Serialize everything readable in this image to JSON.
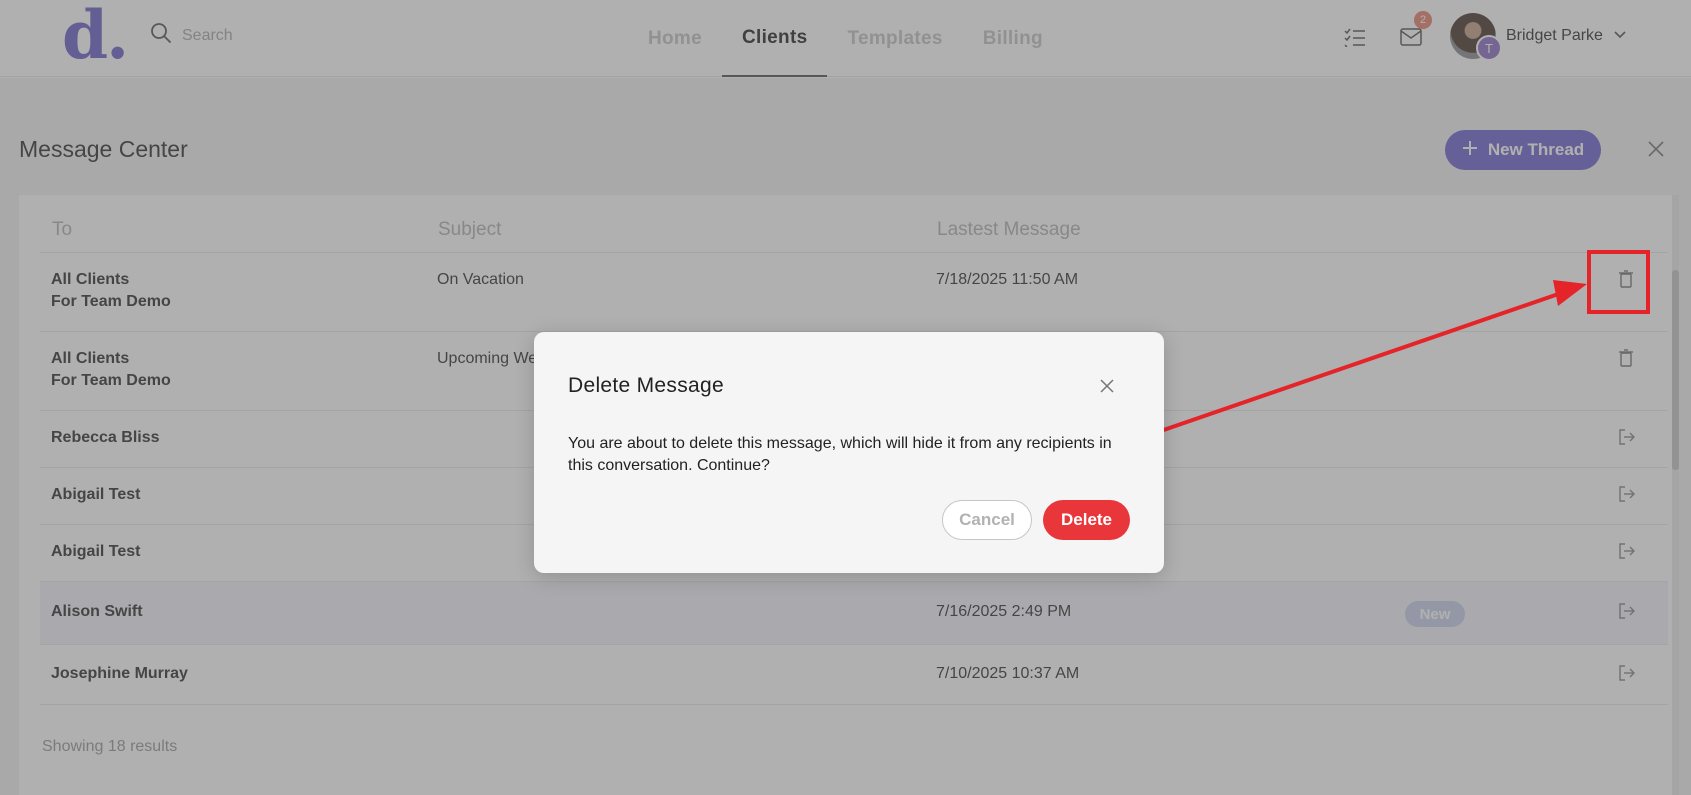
{
  "header": {
    "logo": "d.",
    "search_placeholder": "Search",
    "nav": [
      {
        "label": "Home"
      },
      {
        "label": "Clients"
      },
      {
        "label": "Templates"
      },
      {
        "label": "Billing"
      }
    ],
    "active_nav": "Clients",
    "messages_badge": "2",
    "user": {
      "name": "Bridget Parke",
      "avatar_initial": "T"
    }
  },
  "page": {
    "title": "Message Center",
    "new_thread_label": "New Thread",
    "columns": {
      "to": "To",
      "subject": "Subject",
      "latest": "Lastest Message"
    },
    "rows": [
      {
        "to_line1": "All Clients",
        "to_line2": "For Team Demo",
        "subject": "On Vacation",
        "latest": "7/18/2025 11:50 AM",
        "new": "",
        "action": "trash-icon"
      },
      {
        "to_line1": "All Clients",
        "to_line2": "For Team Demo",
        "subject": "Upcoming We",
        "latest": "",
        "new": "",
        "action": "trash-icon"
      },
      {
        "to_line1": "Rebecca Bliss",
        "to_line2": "",
        "subject": "",
        "latest": "",
        "new": "",
        "action": "open-thread-icon"
      },
      {
        "to_line1": "Abigail Test",
        "to_line2": "",
        "subject": "",
        "latest": "",
        "new": "",
        "action": "open-thread-icon"
      },
      {
        "to_line1": "Abigail Test",
        "to_line2": "",
        "subject": "",
        "latest": "",
        "new": "",
        "action": "open-thread-icon"
      },
      {
        "to_line1": "Alison Swift",
        "to_line2": "",
        "subject": "",
        "latest": "7/16/2025 2:49 PM",
        "new": "New",
        "action": "open-thread-icon"
      },
      {
        "to_line1": "Josephine Murray",
        "to_line2": "",
        "subject": "",
        "latest": "7/10/2025 10:37 AM",
        "new": "",
        "action": "open-thread-icon"
      }
    ],
    "results_text": "Showing 18 results"
  },
  "modal": {
    "title": "Delete Message",
    "body": "You are about to delete this message, which will hide it from any recipients in this conversation. Continue?",
    "cancel_label": "Cancel",
    "delete_label": "Delete"
  },
  "colors": {
    "brand": "#6c63c9",
    "danger": "#e8363b",
    "annotation": "#e5242a",
    "badge": "#e8826f"
  }
}
